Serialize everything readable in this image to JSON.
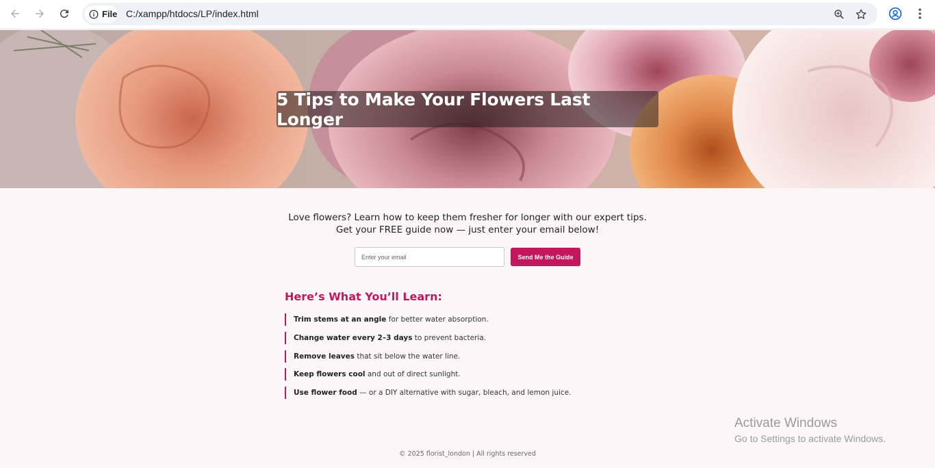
{
  "browser": {
    "site_info_label": "File",
    "url": "C:/xampp/htdocs/LP/index.html"
  },
  "hero": {
    "title": "5 Tips to Make Your Flowers Last Longer"
  },
  "intro": {
    "line1": "Love flowers? Learn how to keep them fresher for longer with our expert tips.",
    "line2": "Get your FREE guide now — just enter your email below!"
  },
  "signup": {
    "email_placeholder": "Enter your email",
    "button_label": "Send Me the Guide"
  },
  "learn": {
    "heading": "Here’s What You’ll Learn:",
    "items": [
      {
        "bold": "Trim stems at an angle",
        "rest": " for better water absorption."
      },
      {
        "bold": "Change water every 2–3 days",
        "rest": " to prevent bacteria."
      },
      {
        "bold": "Remove leaves",
        "rest": " that sit below the water line."
      },
      {
        "bold": "Keep flowers cool",
        "rest": " and out of direct sunlight."
      },
      {
        "bold": "Use flower food",
        "rest": " — or a DIY alternative with sugar, bleach, and lemon juice."
      }
    ]
  },
  "watermark": {
    "title": "Activate Windows",
    "subtitle": "Go to Settings to activate Windows."
  },
  "footer": {
    "text": "© 2025 florist_london | All rights reserved"
  },
  "colors": {
    "accent": "#c2185b",
    "page_background": "#fdf6f8"
  }
}
